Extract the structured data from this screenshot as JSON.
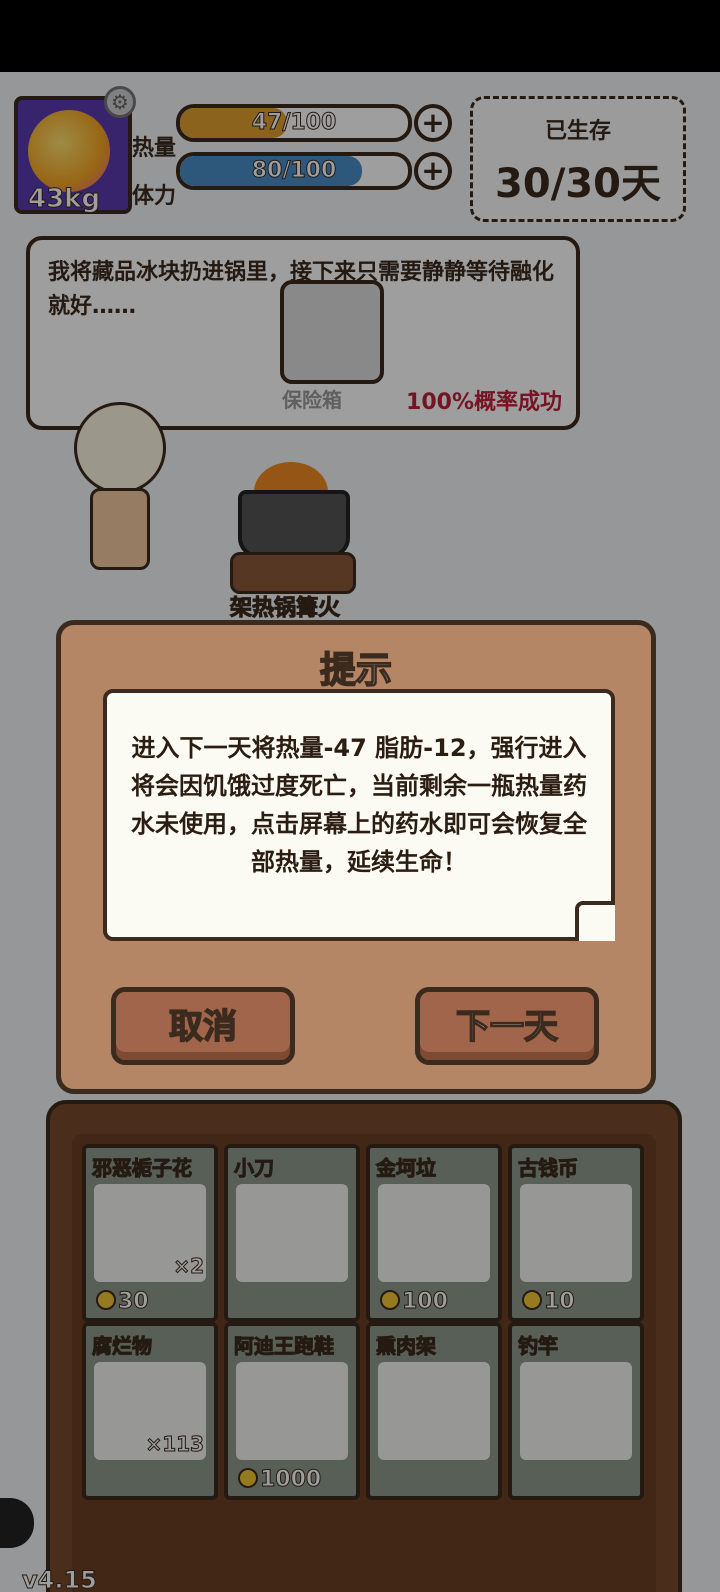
{
  "hud": {
    "weight": "43kg",
    "heat_label": "热量",
    "heat_value": "47/100",
    "heat_fraction": 0.47,
    "stamina_label": "体力",
    "stamina_value": "80/100",
    "stamina_fraction": 0.8,
    "survived_label": "已生存",
    "survived_days": "30/30天"
  },
  "story": {
    "text": "我将藏品冰块扔进锅里，接下来只需要静静等待融化就好……",
    "safe_label": "保险箱",
    "chance": "100%概率成功"
  },
  "scene": {
    "pot_label": "架热锅篝火"
  },
  "inventory": {
    "items": [
      {
        "name": "邪恶栀子花",
        "price": "30",
        "count": "×2"
      },
      {
        "name": "小刀",
        "price": "",
        "count": ""
      },
      {
        "name": "金坷垃",
        "price": "100",
        "count": ""
      },
      {
        "name": "古钱币",
        "price": "10",
        "count": ""
      },
      {
        "name": "腐烂物",
        "price": "",
        "count": "×113"
      },
      {
        "name": "阿迪王跑鞋",
        "price": "1000",
        "count": ""
      },
      {
        "name": "熏肉架",
        "price": "",
        "count": ""
      },
      {
        "name": "钓竿",
        "price": "",
        "count": ""
      }
    ]
  },
  "version": "v4.15",
  "dialog": {
    "title": "提示",
    "message": "进入下一天将热量-47 脂肪-12，强行进入将会因饥饿过度死亡，当前剩余一瓶热量药水未使用，点击屏幕上的药水即可会恢复全部热量，延续生命！",
    "cancel_label": "取消",
    "next_day_label": "下一天"
  },
  "colors": {
    "heat_bar": "#e0a030",
    "stamina_bar": "#4a8fc8",
    "chance_text": "#c0213a",
    "dialog_bg": "#b58665"
  }
}
